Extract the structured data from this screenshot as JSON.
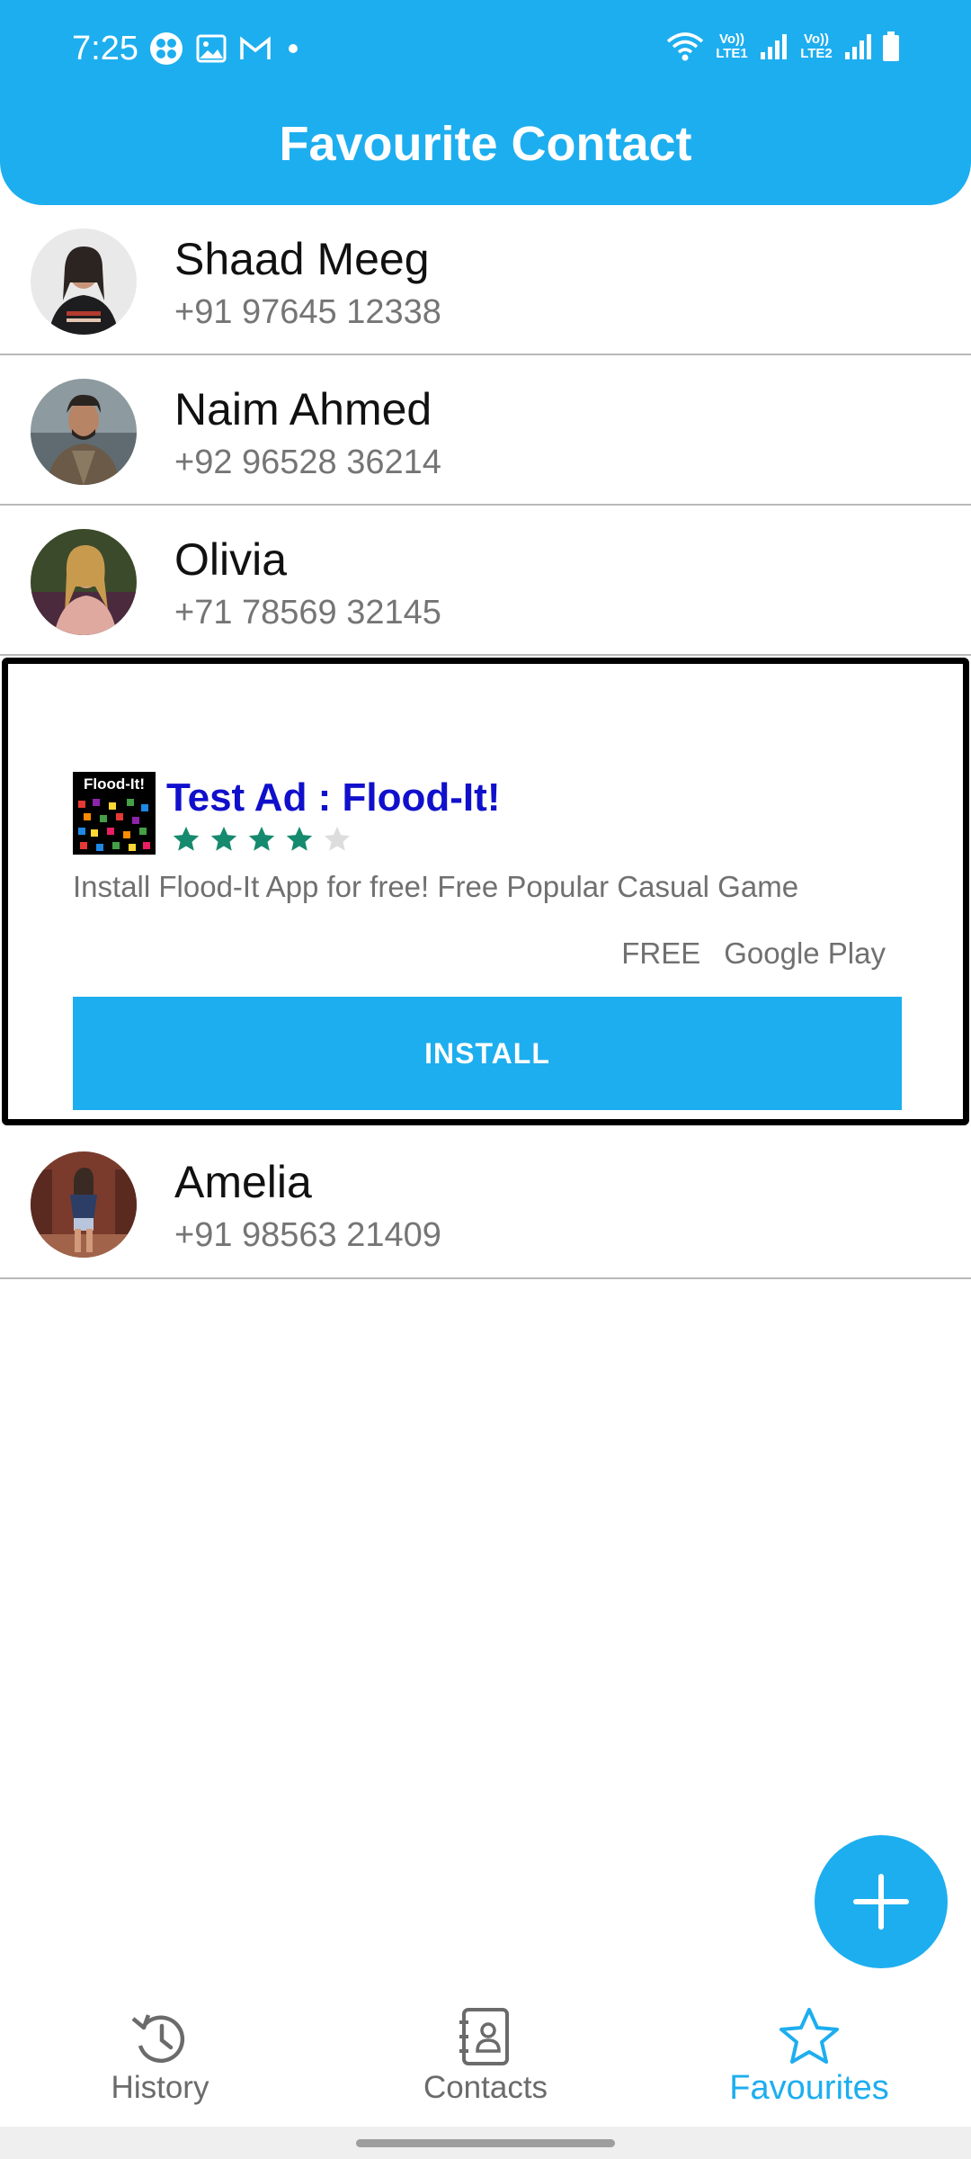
{
  "status_bar": {
    "time": "7:25",
    "sim1_label": "Vo)) LTE1",
    "sim2_label": "Vo)) LTE2",
    "left_icons": [
      "pinwheel-icon",
      "gallery-icon",
      "gmail-icon",
      "dot-icon"
    ],
    "right_icons": [
      "wifi-icon",
      "signal-icon",
      "signal-icon",
      "battery-icon"
    ]
  },
  "header": {
    "title": "Favourite Contact",
    "color": "#1DAEEF"
  },
  "contacts": [
    {
      "name": "Shaad Meeg",
      "phone": "+91 97645 12338"
    },
    {
      "name": "Naim Ahmed",
      "phone": "+92 96528 36214"
    },
    {
      "name": "Olivia",
      "phone": "+71 78569 32145"
    },
    {
      "name": "Amelia",
      "phone": "+91 98563 21409"
    }
  ],
  "ad": {
    "icon_text": "Flood-It!",
    "title": "Test Ad : Flood-It!",
    "rating": 4,
    "rating_max": 5,
    "description": "Install Flood-It App for free! Free Popular Casual Game",
    "price": "FREE",
    "store": "Google Play",
    "install_label": "INSTALL"
  },
  "fab": {
    "icon": "plus-icon"
  },
  "bottom_nav": {
    "items": [
      {
        "label": "History",
        "icon": "history-icon",
        "active": false
      },
      {
        "label": "Contacts",
        "icon": "contacts-book-icon",
        "active": false
      },
      {
        "label": "Favourites",
        "icon": "star-icon",
        "active": true
      }
    ],
    "active_color": "#1DAEEF"
  }
}
